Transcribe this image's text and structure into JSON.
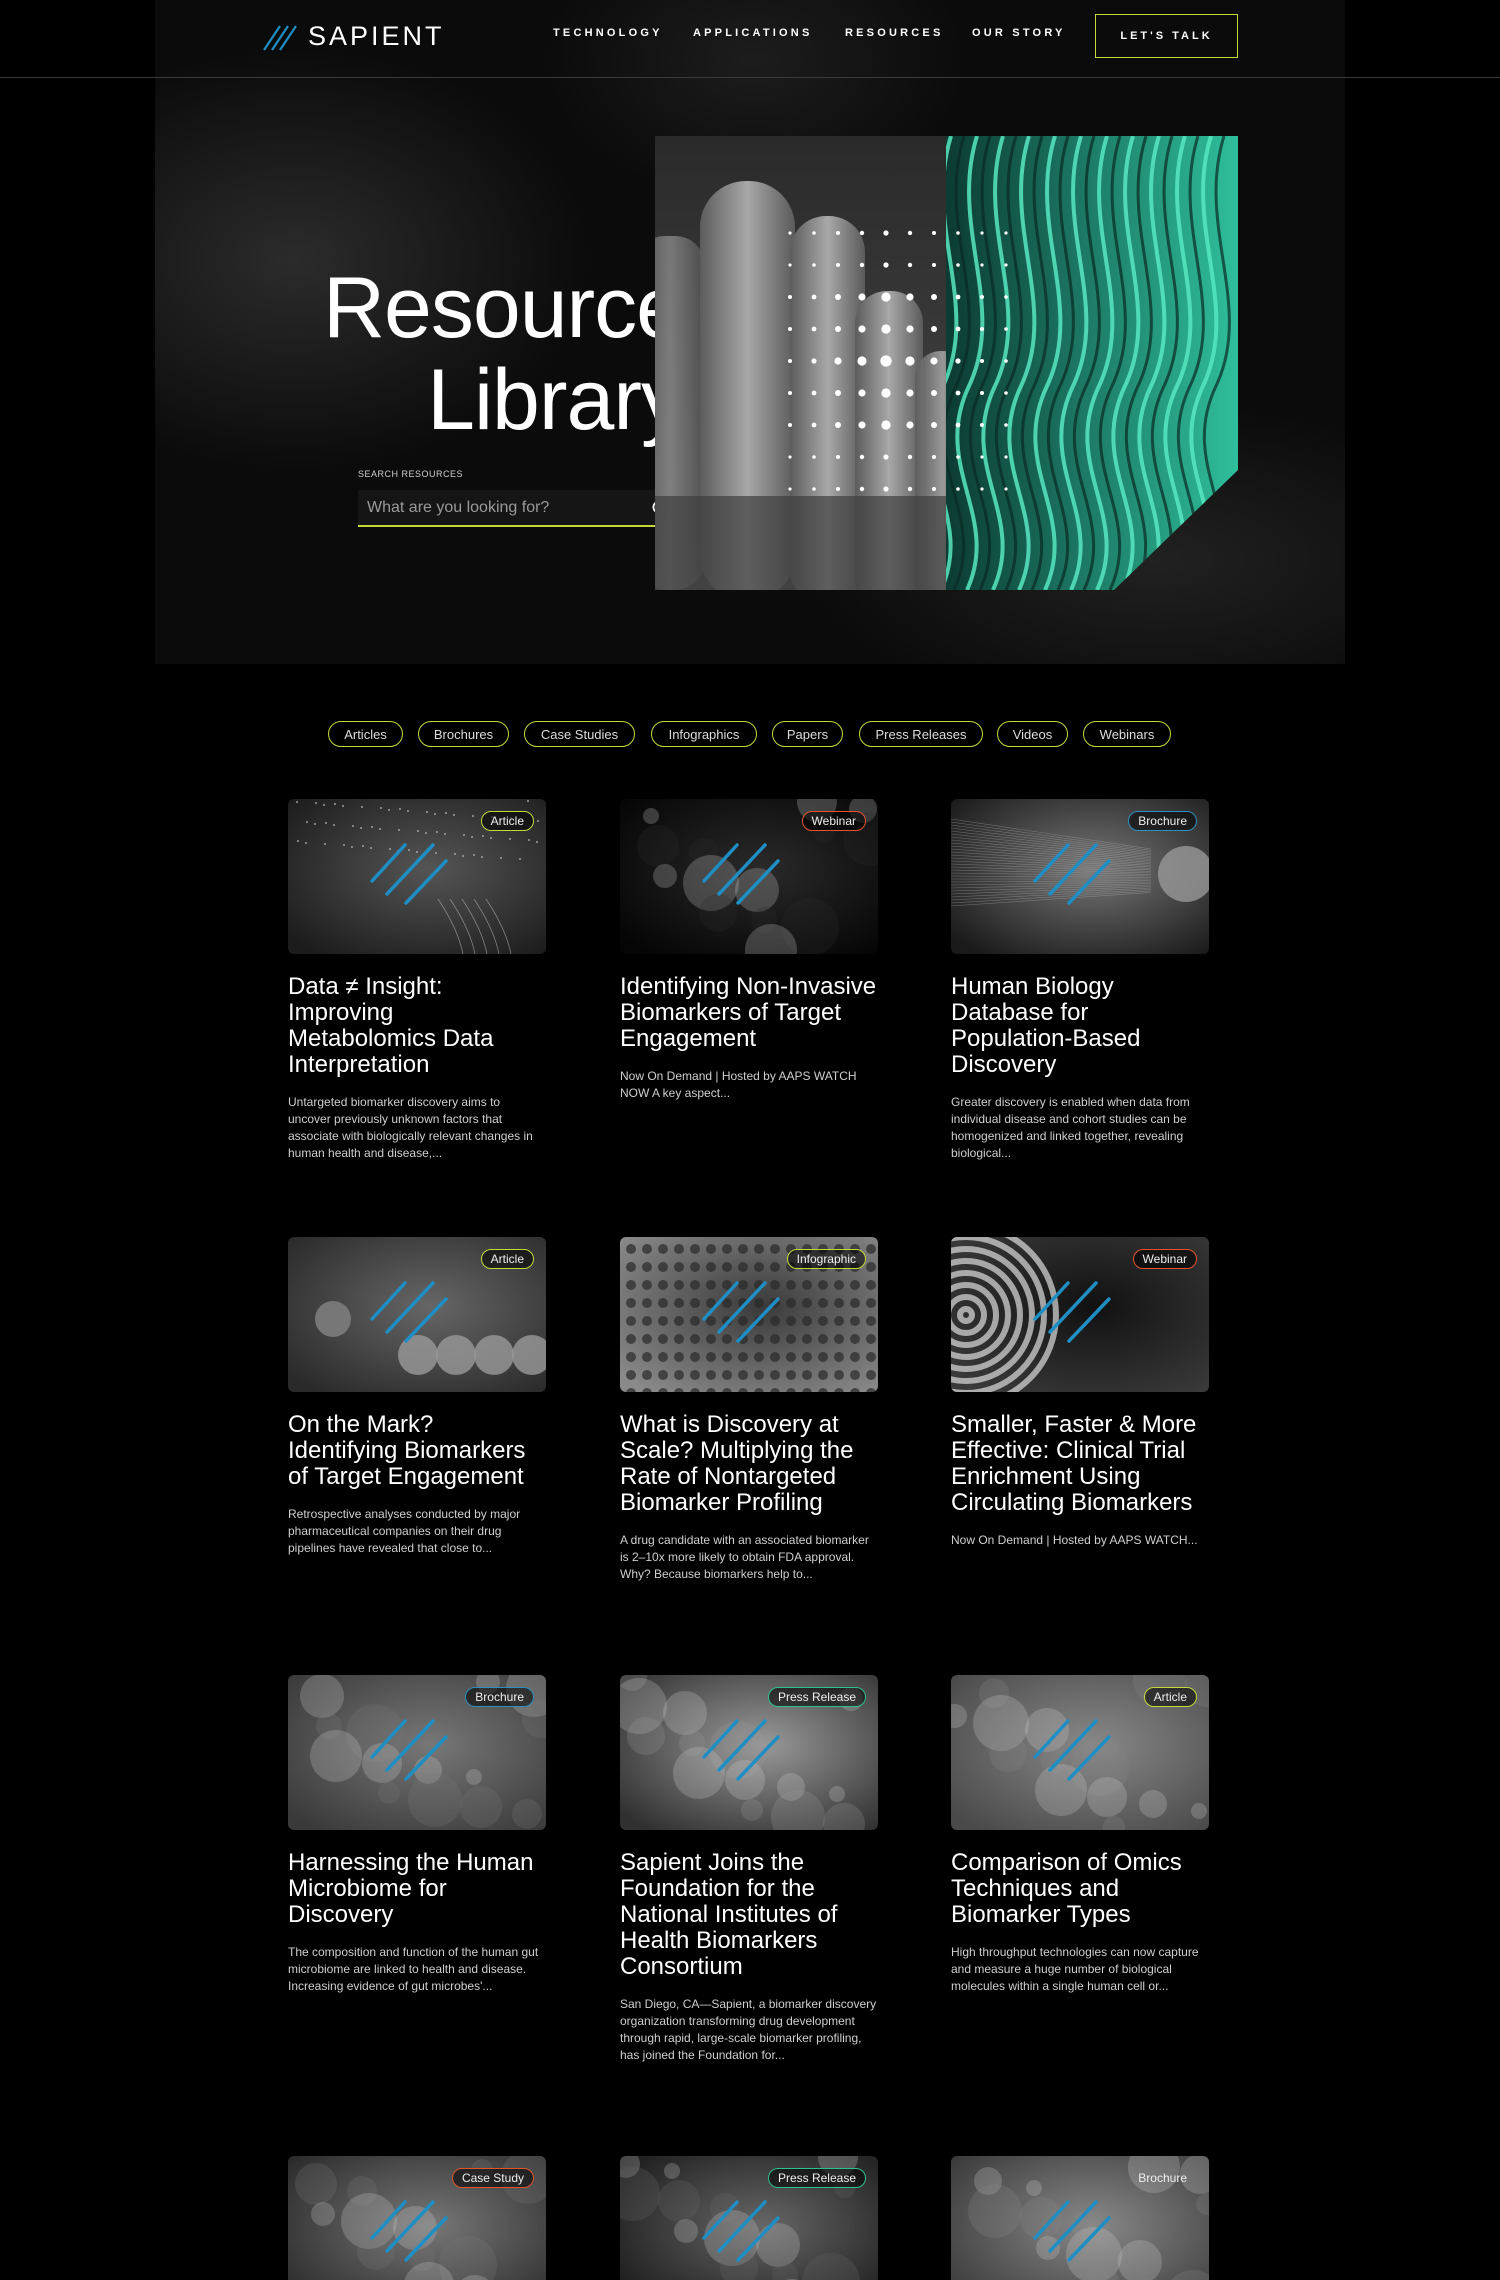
{
  "brand": {
    "name": "SAPIENT"
  },
  "nav": {
    "items": [
      {
        "label": "TECHNOLOGY"
      },
      {
        "label": "APPLICATIONS"
      },
      {
        "label": "RESOURCES"
      },
      {
        "label": "OUR STORY"
      }
    ],
    "cta_label": "LET'S TALK"
  },
  "hero": {
    "title_line1": "Resource",
    "title_line2": "Library",
    "search_label": "SEARCH RESOURCES",
    "search_placeholder": "What are you looking for?"
  },
  "filters": [
    "Articles",
    "Brochures",
    "Case Studies",
    "Infographics",
    "Papers",
    "Press Releases",
    "Videos",
    "Webinars"
  ],
  "colors": {
    "accent": "#c6d93a",
    "stripe": "#1f8ec4",
    "badge_orange": "#e0552c",
    "badge_blue": "#2f8fc0",
    "badge_teal": "#2fbf92"
  },
  "cards": [
    {
      "badge": "Article",
      "badge_color": "green",
      "image": "particle-streams",
      "title": "Data ≠ Insight: Improving Metabolomics Data Interpretation",
      "desc": "Untargeted biomarker discovery aims to uncover previously unknown factors that associate with biologically relevant changes in human health and disease,..."
    },
    {
      "badge": "Webinar",
      "badge_color": "orange",
      "image": "dark-smoke",
      "title": "Identifying Non-Invasive Biomarkers of Target Engagement",
      "desc": "Now On Demand | Hosted by AAPS WATCH NOW A key aspect..."
    },
    {
      "badge": "Brochure",
      "badge_color": "blue",
      "image": "earth-data-streams",
      "title": "Human Biology Database for Population-Based Discovery",
      "desc": "Greater discovery is enabled when data from individual disease and cohort studies can be homogenized and linked together, revealing biological..."
    },
    {
      "badge": "Article",
      "badge_color": "green",
      "image": "newtons-cradle",
      "title": "On the Mark? Identifying Biomarkers of Target Engagement",
      "desc": "Retrospective analyses conducted by major pharmaceutical companies on their drug pipelines have revealed that close to..."
    },
    {
      "badge": "Infographic",
      "badge_color": "green",
      "image": "face-grid",
      "title": "What is Discovery at Scale? Multiplying the Rate of Nontargeted Biomarker Profiling",
      "desc": "A drug candidate with an associated biomarker is 2–10x more likely to obtain FDA approval. Why? Because biomarkers help to..."
    },
    {
      "badge": "Webinar",
      "badge_color": "orange",
      "image": "dart-target",
      "title": "Smaller, Faster & More Effective: Clinical Trial Enrichment Using Circulating Biomarkers",
      "desc": "Now On Demand | Hosted by AAPS WATCH..."
    },
    {
      "badge": "Brochure",
      "badge_color": "blue",
      "image": "microbiome",
      "title": "Harnessing the Human Microbiome for Discovery",
      "desc": "The composition and function of the human gut microbiome are linked to health and disease. Increasing evidence of gut microbes'..."
    },
    {
      "badge": "Press Release",
      "badge_color": "teal",
      "image": "cells",
      "title": "Sapient Joins the Foundation for the National Institutes of Health Biomarkers Consortium",
      "desc": "San Diego, CA—Sapient, a biomarker discovery organization transforming drug development through rapid, large-scale biomarker profiling, has joined the Foundation for..."
    },
    {
      "badge": "Article",
      "badge_color": "green",
      "image": "molecule",
      "title": "Comparison of Omics Techniques and Biomarker Types",
      "desc": "High throughput technologies can now capture and measure a huge number of biological molecules within a single human cell or..."
    },
    {
      "badge": "Case Study",
      "badge_color": "orange",
      "image": "texture",
      "title": "",
      "desc": ""
    },
    {
      "badge": "Press Release",
      "badge_color": "teal",
      "image": "organisms",
      "title": "",
      "desc": ""
    },
    {
      "badge": "Brochure",
      "badge_color": "none",
      "image": "particles",
      "title": "",
      "desc": ""
    }
  ]
}
